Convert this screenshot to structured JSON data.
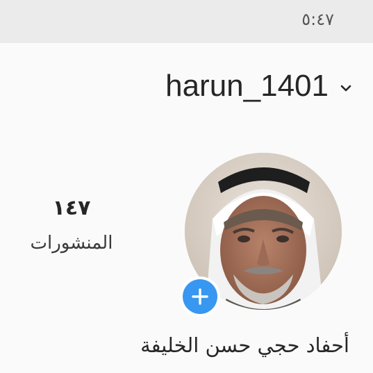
{
  "status_bar": {
    "time": "٥:٤٧"
  },
  "header": {
    "username": "harun_1401",
    "dropdown_icon": "chevron-down-icon"
  },
  "profile": {
    "avatar_icon": "profile-photo",
    "add_story_icon": "plus-icon",
    "full_name": "أحفاد حجي حسن الخليفة",
    "accent_color": "#3897f0"
  },
  "stats": [
    {
      "count": "١٤٧",
      "label": "المنشورات"
    }
  ]
}
